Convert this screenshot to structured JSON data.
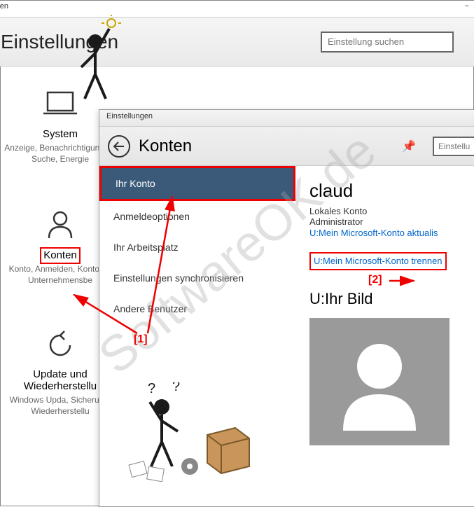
{
  "bg": {
    "titlebar": "lungen",
    "header_title": "Einstellungen",
    "search_placeholder": "Einstellung suchen",
    "tiles": [
      {
        "name": "System",
        "desc": "Anzeige, Benachrichtigungen, Suche, Energie"
      },
      {
        "name": "Konten",
        "desc": "Konto, Anmelden, Konto für Unternehmensbe"
      },
      {
        "name": "Update und Wiederherstellu",
        "desc": "Windows Upda, Sicherung, Wiederherstellu"
      }
    ]
  },
  "fg": {
    "titlebar": "Einstellungen",
    "header_title": "Konten",
    "search_placeholder": "Einstellu",
    "sidebar": [
      {
        "label": "Ihr Konto",
        "active": true
      },
      {
        "label": "Anmeldeoptionen"
      },
      {
        "label": "Ihr Arbeitsplatz"
      },
      {
        "label": "Einstellungen synchronisieren"
      },
      {
        "label": "Andere Benutzer"
      }
    ],
    "user": {
      "name": "claud",
      "type": "Lokales Konto",
      "role": "Administrator",
      "link_update": "U:Mein Microsoft-Konto aktualis",
      "link_disconnect": "U:Mein Microsoft-Konto trennen",
      "pic_heading": "U:Ihr Bild"
    }
  },
  "annotations": {
    "label1": "[1]",
    "label2": "[2]"
  },
  "watermark": "SoftwareOK.de"
}
